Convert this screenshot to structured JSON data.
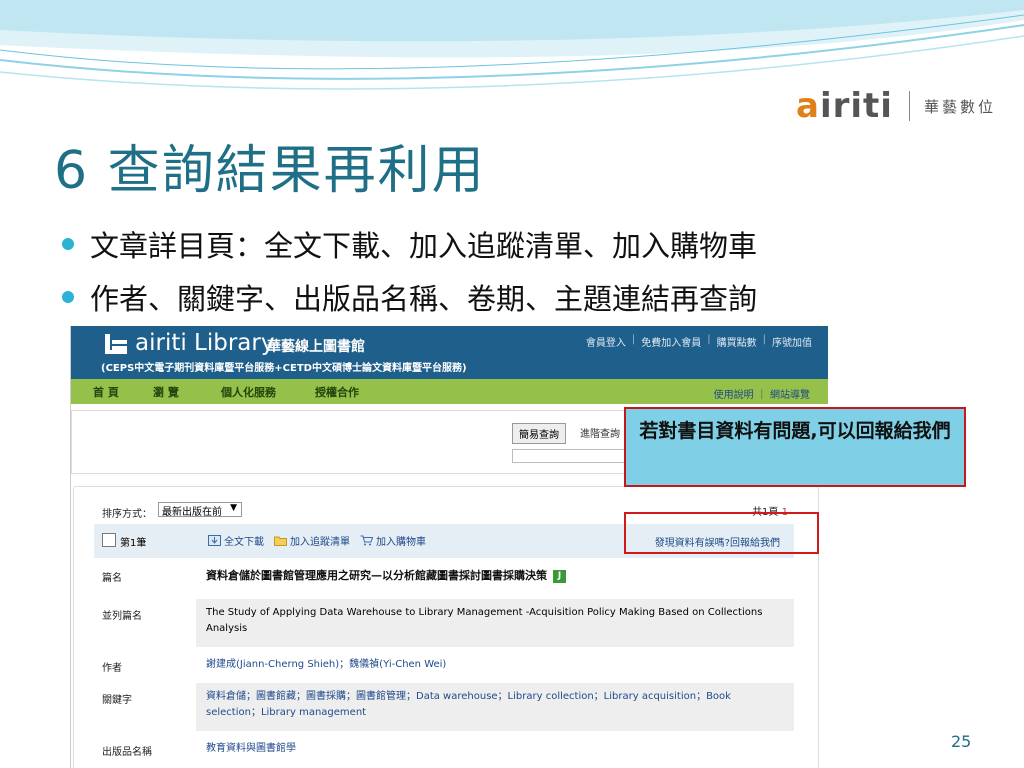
{
  "slide": {
    "title": "6 查詢結果再利用",
    "bullets": [
      "文章詳目頁：全文下載、加入追蹤清單、加入購物車",
      "作者、關鍵字、出版品名稱、卷期、主題連結再查詢"
    ],
    "page_number": "25",
    "callout": "若對書目資料有問題,可以回報給我們"
  },
  "logo": {
    "brand_a": "a",
    "brand_rest": "iriti",
    "cn": "華藝數位"
  },
  "site": {
    "name": "airiti Library",
    "name_cn": "華藝線上圖書館",
    "subtitle": "(CEPS中文電子期刊資料庫暨平台服務+CETD中文碩博士論文資料庫暨平台服務)",
    "top_links": [
      "會員登入",
      "免費加入會員",
      "購買點數",
      "序號加值"
    ],
    "nav": [
      "首 頁",
      "瀏 覽",
      "個人化服務",
      "授權合作"
    ],
    "nav_help": "使用說明 ｜ 網站導覽",
    "search_tabs": [
      "簡易查詢",
      "進階查詢"
    ]
  },
  "results": {
    "sort_label": "排序方式：",
    "sort_value": "最新出版在前",
    "page_count_prefix": "共1頁",
    "page_current": "1",
    "record_no": "第1筆",
    "actions": [
      "全文下載",
      "加入追蹤清單",
      "加入購物車"
    ],
    "report_link": "發現資料有誤嗎?回報給我們",
    "fields": [
      {
        "label": "篇名",
        "value": "資料倉儲於圖書館管理應用之研究—以分析館藏圖書採討圖書採購決策"
      },
      {
        "label": "並列篇名",
        "value": "The Study of Applying Data Warehouse to Library Management -Acquisition Policy  Making Based on Collections Analysis"
      },
      {
        "label": "作者",
        "value": "謝建成(Jiann-Cherng Shieh)；魏儀禎(Yi-Chen Wei)"
      },
      {
        "label": "關鍵字",
        "value": "資料倉儲；圖書館藏；圖書採購；圖書館管理；Data warehouse；Library collection；Library acquisition；Book selection；Library management"
      },
      {
        "label": "出版品名稱",
        "value": "教育資料與圖書館學"
      }
    ],
    "badge": "J"
  },
  "colors": {
    "title": "#1f6f86",
    "header": "#1f5f8b",
    "nav": "#95c14b",
    "callout_bg": "#7fd0e6",
    "callout_border": "#c21a1a"
  }
}
